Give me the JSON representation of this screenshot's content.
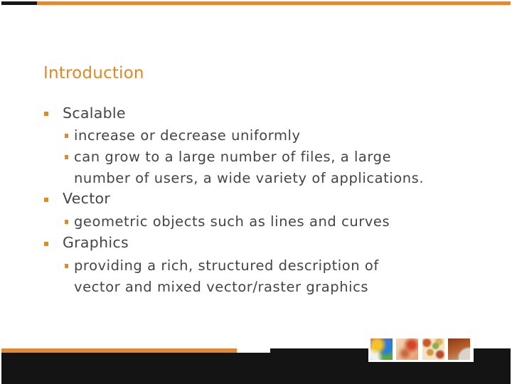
{
  "slide": {
    "title": "Introduction",
    "bullets": [
      {
        "text": "Scalable",
        "sub": [
          {
            "lines": [
              "increase or decrease uniformly"
            ]
          },
          {
            "lines": [
              "can grow to a large number of files, a large",
              "number of users, a wide variety of applications."
            ]
          }
        ]
      },
      {
        "text": "Vector",
        "sub": [
          {
            "lines": [
              "geometric objects such as lines and curves"
            ]
          }
        ]
      },
      {
        "text": "Graphics",
        "sub": [
          {
            "lines": [
              "providing a rich, structured description of",
              "vector and mixed vector/raster graphics"
            ]
          }
        ]
      }
    ]
  },
  "theme": {
    "accent": "#e08a38",
    "title_color": "#dc8a24",
    "text_color": "#454545",
    "footer_color": "#141414"
  },
  "footer": {
    "thumbnails": [
      "colorful-splatter-image",
      "peach-splatter-image",
      "mosaic-dots-image",
      "brown-texture-image"
    ]
  }
}
